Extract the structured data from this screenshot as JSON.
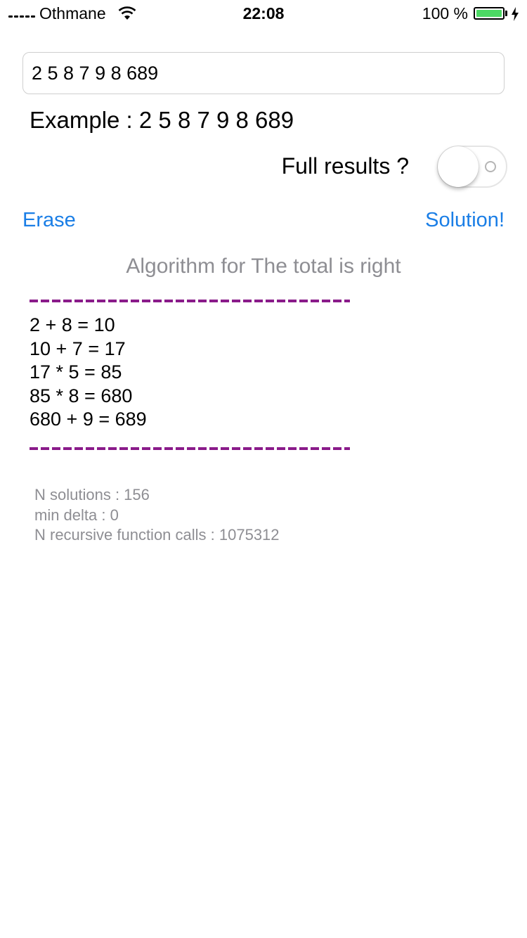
{
  "status_bar": {
    "carrier": "Othmane",
    "time": "22:08",
    "battery_percent": "100 %",
    "battery_color": "#4cd964"
  },
  "input": {
    "value": "2 5 8 7 9 8 689"
  },
  "example_label": "Example : 2 5 8 7 9 8 689",
  "full_results": {
    "label": "Full results ?",
    "enabled": false
  },
  "buttons": {
    "erase": "Erase",
    "solution": "Solution!",
    "accent_color": "#1a7ee6"
  },
  "result": {
    "title": "Algorithm for The total is right",
    "separator_color": "#8a1b8a",
    "steps": [
      "2 + 8 = 10",
      "10 + 7 = 17",
      "17 * 5 = 85",
      "85 * 8 = 680",
      "680 + 9 = 689"
    ]
  },
  "stats": {
    "n_solutions": "N solutions : 156",
    "min_delta": "min delta : 0",
    "recursive_calls": "N recursive function calls : 1075312"
  }
}
